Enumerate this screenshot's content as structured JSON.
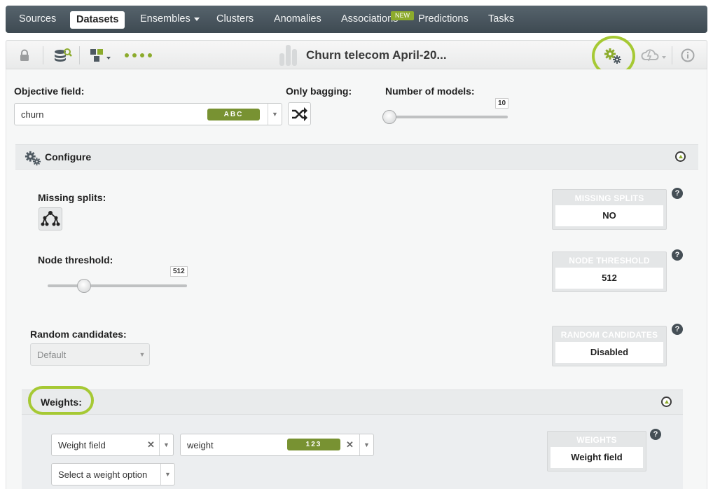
{
  "nav": {
    "items": [
      "Sources",
      "Datasets",
      "Ensembles",
      "Clusters",
      "Anomalies",
      "Associations",
      "Predictions",
      "Tasks"
    ],
    "active": "Datasets",
    "new_badge": "NEW"
  },
  "toolbar": {
    "title": "Churn telecom April-20..."
  },
  "form": {
    "objective_label": "Objective field:",
    "objective_value": "churn",
    "objective_type": "ABC",
    "bagging_label": "Only bagging:",
    "models_label": "Number of models:",
    "models_value": "10",
    "models_fraction": 0.0
  },
  "configure": {
    "title": "Configure",
    "missing_splits_label": "Missing splits:",
    "node_threshold_label": "Node threshold:",
    "node_threshold_value": "512",
    "node_threshold_fraction": 0.26,
    "random_candidates_label": "Random candidates:",
    "random_candidates_value": "Default"
  },
  "summary": {
    "missing_splits": {
      "title": "MISSING SPLITS",
      "value": "NO"
    },
    "node_threshold": {
      "title": "NODE THRESHOLD",
      "value": "512"
    },
    "random_candidates": {
      "title": "RANDOM CANDIDATES",
      "value": "Disabled"
    },
    "weights": {
      "title": "WEIGHTS",
      "value": "Weight field"
    }
  },
  "weights": {
    "title": "Weights:",
    "type_value": "Weight field",
    "field_value": "weight",
    "field_type": "123",
    "option_placeholder": "Select a weight option"
  },
  "help_symbol": "?",
  "colors": {
    "accent": "#a6c934",
    "nav_bg": "#4a565e",
    "pill": "#789232"
  }
}
